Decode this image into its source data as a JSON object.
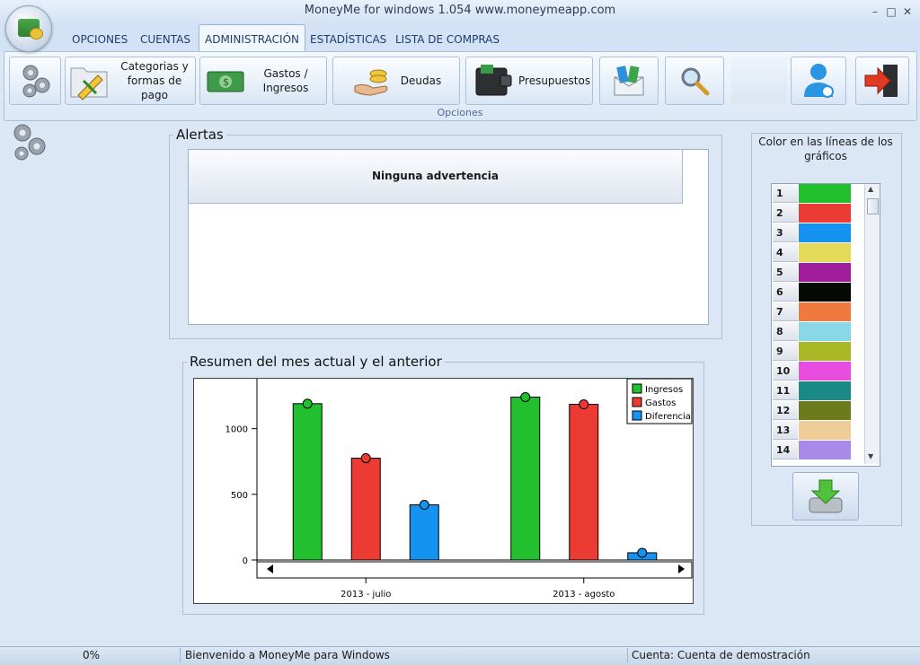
{
  "window": {
    "title": "MoneyMe for windows 1.054 www.moneymeapp.com",
    "controls": [
      "–",
      "□",
      "✕"
    ]
  },
  "tabs": [
    {
      "label": "OPCIONES"
    },
    {
      "label": "CUENTAS"
    },
    {
      "label": "ADMINISTRACIÓN"
    },
    {
      "label": "ESTADÍSTICAS"
    },
    {
      "label": "LISTA DE COMPRAS"
    }
  ],
  "active_tab": "ADMINISTRACIÓN",
  "ribbon": {
    "group_label": "Opciones",
    "buttons": {
      "settings": {
        "label": ""
      },
      "categories": {
        "label": "Categorias y formas de pago"
      },
      "gastos": {
        "label": "Gastos / Ingresos"
      },
      "deudas": {
        "label": "Deudas"
      },
      "presupuestos": {
        "label": "Presupuestos"
      },
      "transfer": {
        "label": ""
      },
      "search": {
        "label": ""
      },
      "user": {
        "label": ""
      },
      "exit": {
        "label": ""
      }
    }
  },
  "alerts": {
    "title": "Alertas",
    "message": "Ninguna advertencia"
  },
  "summary": {
    "title": "Resumen del mes actual y el anterior"
  },
  "colors_panel": {
    "title": "Color en las líneas de los gráficos",
    "rows": [
      {
        "n": "1",
        "color": "#22c02e"
      },
      {
        "n": "2",
        "color": "#ec3b32"
      },
      {
        "n": "3",
        "color": "#1493f0"
      },
      {
        "n": "4",
        "color": "#e4da5a"
      },
      {
        "n": "5",
        "color": "#a21c9e"
      },
      {
        "n": "6",
        "color": "#050a05"
      },
      {
        "n": "7",
        "color": "#ee7a40"
      },
      {
        "n": "8",
        "color": "#89d8e8"
      },
      {
        "n": "9",
        "color": "#a9b824"
      },
      {
        "n": "10",
        "color": "#e84de0"
      },
      {
        "n": "11",
        "color": "#1b8a86"
      },
      {
        "n": "12",
        "color": "#6b7a1a"
      },
      {
        "n": "13",
        "color": "#efcd98"
      },
      {
        "n": "14",
        "color": "#a88be8"
      }
    ]
  },
  "statusbar": {
    "progress": "0%",
    "message": "Bienvenido a MoneyMe para Windows",
    "account": "Cuenta: Cuenta de demostración"
  },
  "chart_data": {
    "type": "bar",
    "categories": [
      "2013 - julio",
      "2013 - agosto"
    ],
    "series": [
      {
        "name": "Ingresos",
        "color": "#22c02e",
        "values": [
          1190,
          1240
        ]
      },
      {
        "name": "Gastos",
        "color": "#ec3b32",
        "values": [
          775,
          1185
        ]
      },
      {
        "name": "Diferencia",
        "color": "#1493f0",
        "values": [
          420,
          55
        ]
      }
    ],
    "yticks": [
      0,
      500,
      1000
    ],
    "ylim": [
      0,
      1380
    ],
    "legend": "top-right",
    "grid": false
  }
}
